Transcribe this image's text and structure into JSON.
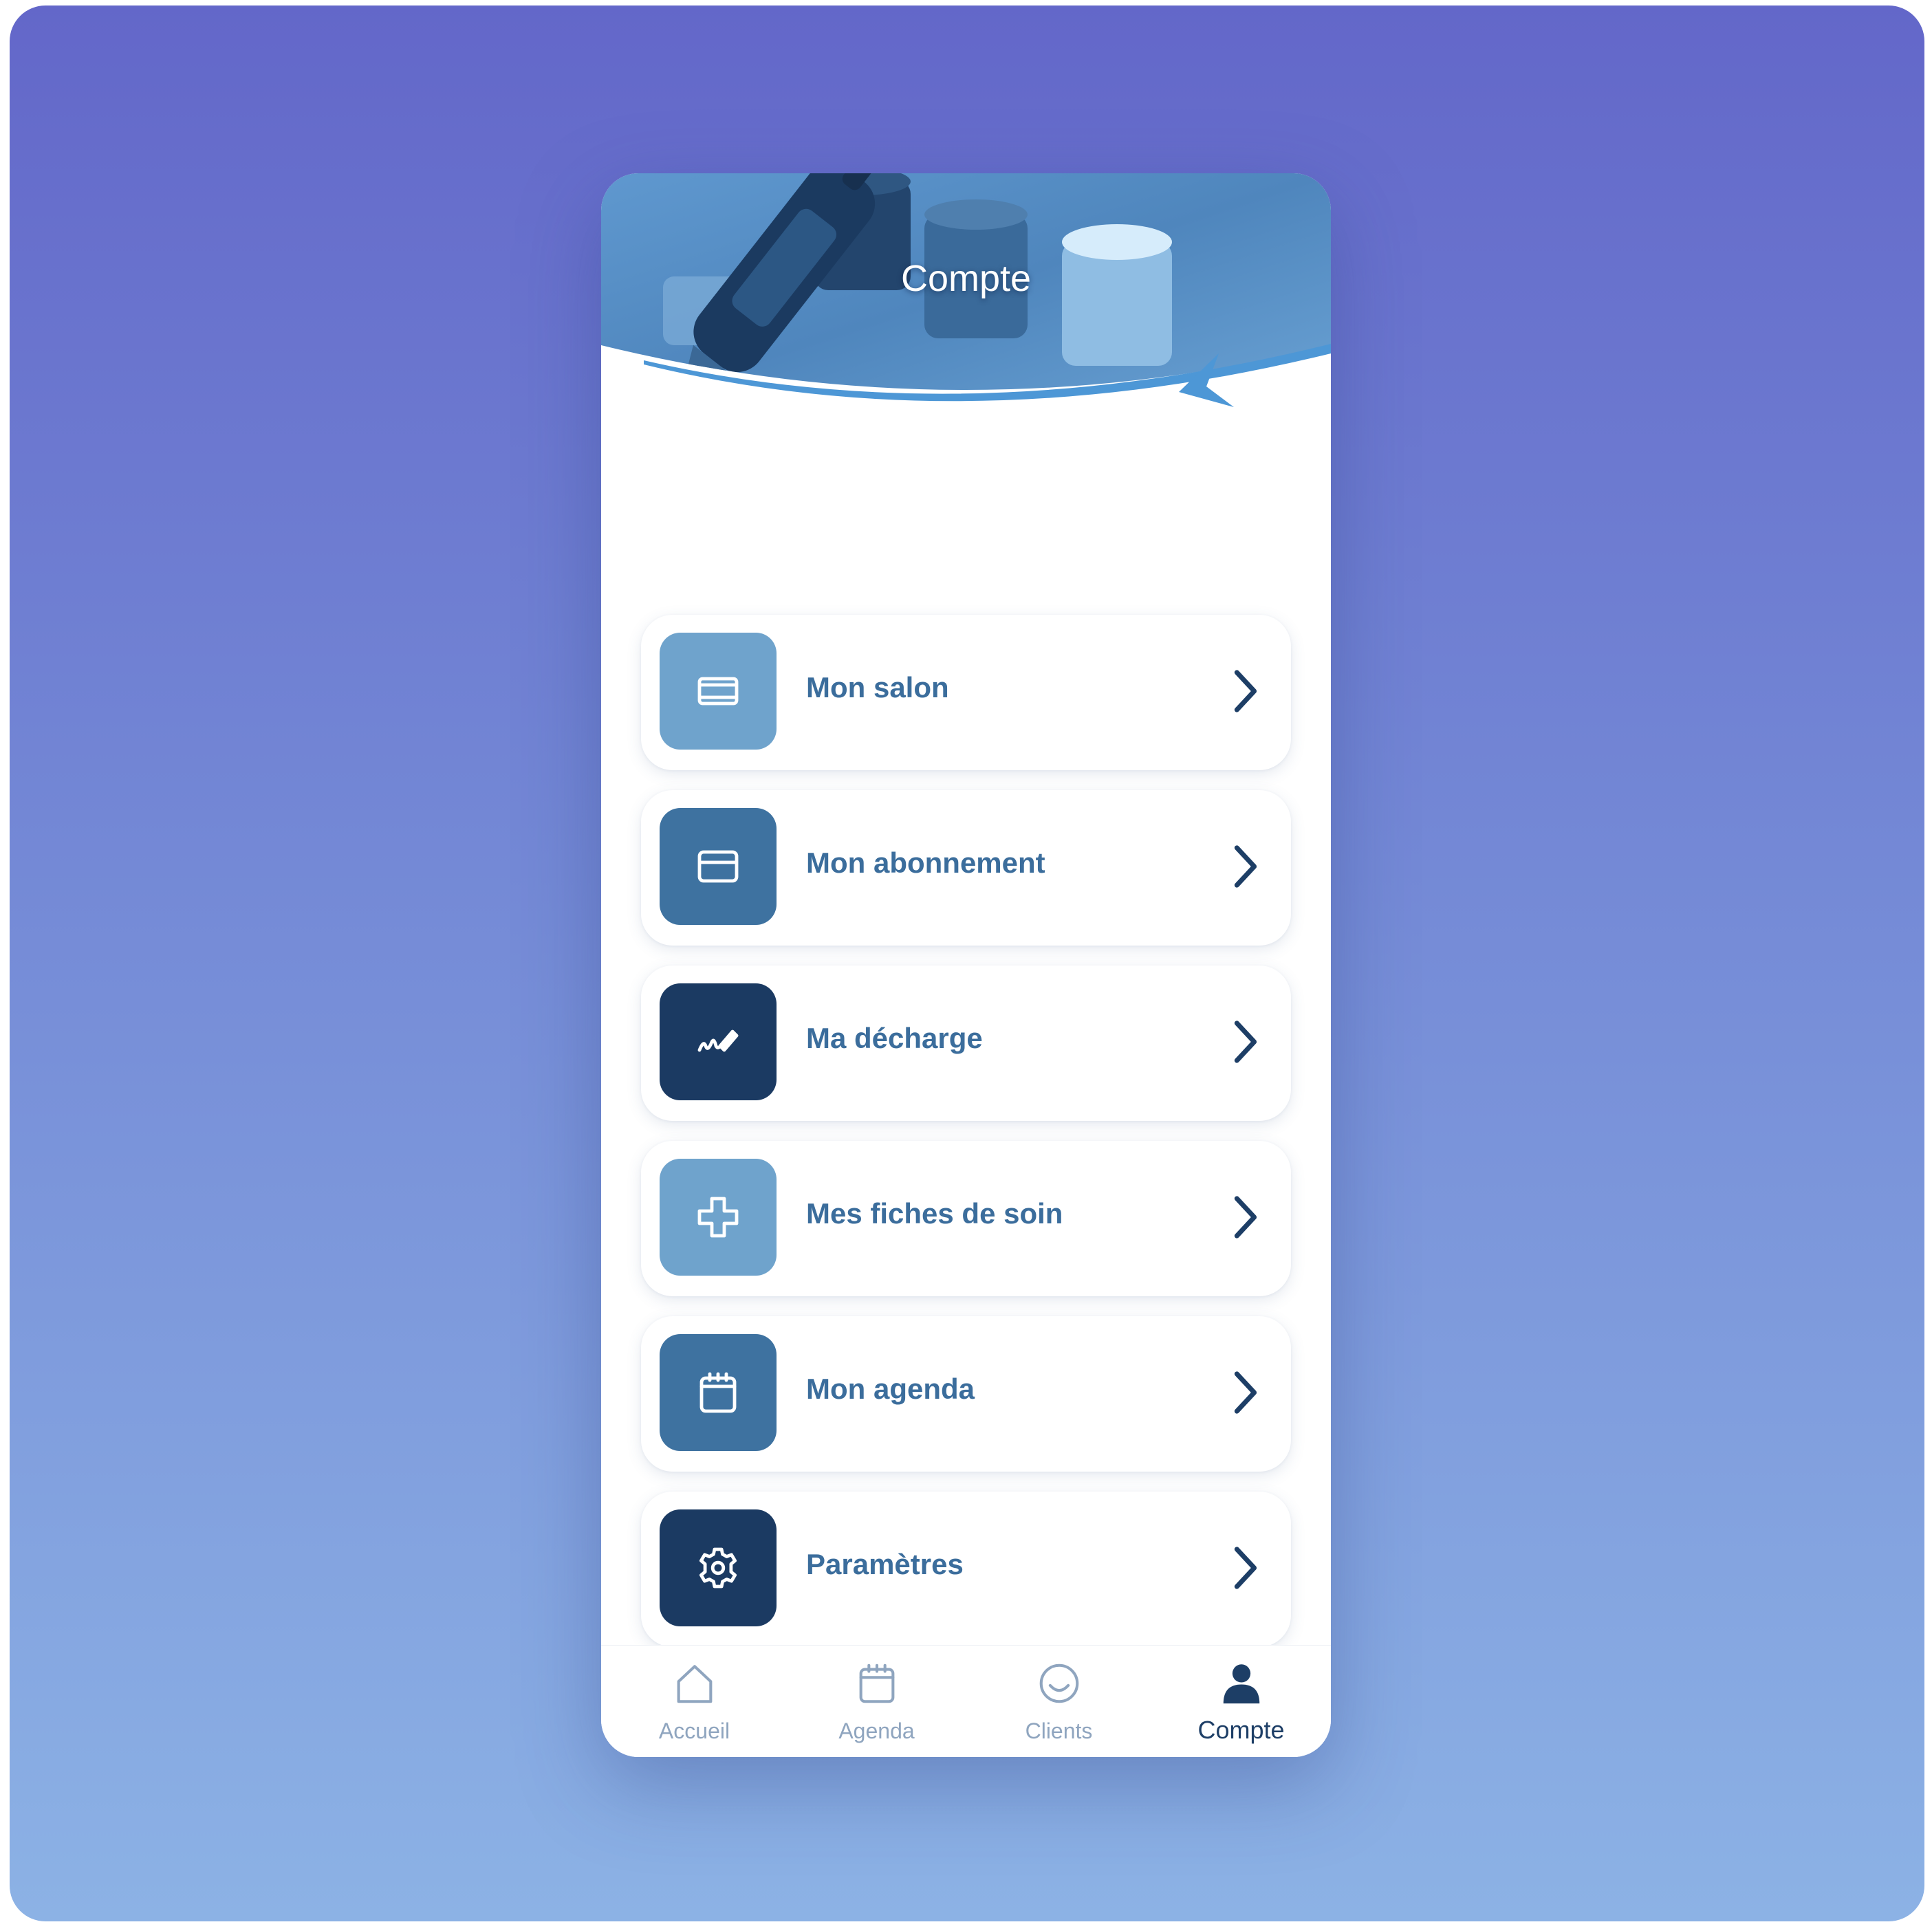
{
  "header": {
    "title": "Compte"
  },
  "menu": {
    "items": [
      {
        "label": "Mon salon",
        "icon": "ticket-icon",
        "icon_color": "#6fa3cc"
      },
      {
        "label": "Mon abonnement",
        "icon": "credit-card-icon",
        "icon_color": "#3e72a0"
      },
      {
        "label": "Ma décharge",
        "icon": "signature-icon",
        "icon_color": "#1b3a62"
      },
      {
        "label": "Mes fiches de soin",
        "icon": "medical-cross-icon",
        "icon_color": "#6fa3cc"
      },
      {
        "label": "Mon agenda",
        "icon": "calendar-icon",
        "icon_color": "#3e72a0"
      },
      {
        "label": "Paramètres",
        "icon": "gear-icon",
        "icon_color": "#1b3a62"
      },
      {
        "label": "",
        "icon": "partial-icon",
        "icon_color": "#6fa3cc"
      }
    ]
  },
  "tabbar": {
    "tabs": [
      {
        "label": "Accueil",
        "icon": "home-icon",
        "active": false
      },
      {
        "label": "Agenda",
        "icon": "calendar-icon",
        "active": false
      },
      {
        "label": "Clients",
        "icon": "smiley-icon",
        "active": false
      },
      {
        "label": "Compte",
        "icon": "user-icon",
        "active": true
      }
    ]
  },
  "colors": {
    "backdrop_top": "#6367c9",
    "backdrop_bottom": "#8cb2e5",
    "label": "#3b6d9c",
    "chevron": "#1d3e66",
    "tab_inactive": "#8fa5bf",
    "tab_active": "#1d3e66"
  }
}
